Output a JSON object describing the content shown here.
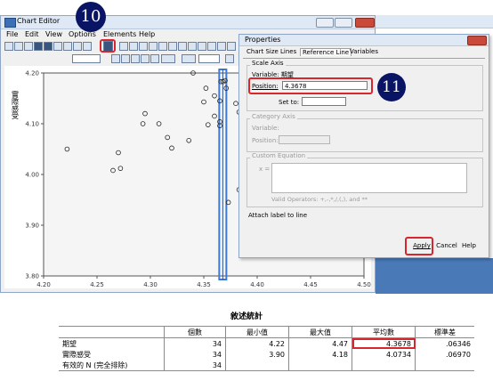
{
  "steps": {
    "first": "10",
    "second": "11"
  },
  "chart_editor": {
    "title": "Chart Editor",
    "menu": [
      "File",
      "Edit",
      "View",
      "Options",
      "Elements",
      "Help"
    ]
  },
  "properties": {
    "title": "Properties",
    "tabs": [
      "Chart Size",
      "Lines",
      "Reference Line",
      "Variables"
    ],
    "scale_axis": {
      "group_label": "Scale Axis",
      "variable_label": "Variable: 期望",
      "position_label": "Position:",
      "position_value": "4.3678",
      "set_to_label": "Set to:"
    },
    "category_axis": {
      "group_label": "Category Axis",
      "variable_label": "Variable:",
      "position_label": "Position:"
    },
    "custom_equation": {
      "group_label": "Custom Equation",
      "x_label": "x =",
      "valid_operators": "Valid Operators: +,-,*,/,(,), and **"
    },
    "attach_label": "Attach label to line",
    "buttons": {
      "apply": "Apply",
      "cancel": "Cancel",
      "help": "Help"
    }
  },
  "chart_data": {
    "type": "scatter",
    "xlabel": "期望",
    "ylabel": "實際感受",
    "xlim": [
      4.2,
      4.5
    ],
    "ylim": [
      3.8,
      4.2
    ],
    "x_ticks": [
      "4.20",
      "4.25",
      "4.30",
      "4.35",
      "4.40",
      "4.45",
      "4.50"
    ],
    "y_ticks": [
      "3.80",
      "3.90",
      "4.00",
      "4.10",
      "4.20"
    ],
    "reference_line_x": 4.3678,
    "points": [
      {
        "x": 4.222,
        "y": 4.05
      },
      {
        "x": 4.265,
        "y": 4.008
      },
      {
        "x": 4.27,
        "y": 4.043
      },
      {
        "x": 4.272,
        "y": 4.012
      },
      {
        "x": 4.293,
        "y": 4.1
      },
      {
        "x": 4.295,
        "y": 4.12
      },
      {
        "x": 4.308,
        "y": 4.1
      },
      {
        "x": 4.316,
        "y": 4.073
      },
      {
        "x": 4.32,
        "y": 4.052
      },
      {
        "x": 4.336,
        "y": 4.067
      },
      {
        "x": 4.35,
        "y": 4.143
      },
      {
        "x": 4.352,
        "y": 4.17
      },
      {
        "x": 4.354,
        "y": 4.098
      },
      {
        "x": 4.36,
        "y": 4.155
      },
      {
        "x": 4.366,
        "y": 4.183
      },
      {
        "x": 4.368,
        "y": 4.183
      },
      {
        "x": 4.36,
        "y": 4.115
      },
      {
        "x": 4.37,
        "y": 4.185
      },
      {
        "x": 4.371,
        "y": 4.17
      },
      {
        "x": 4.365,
        "y": 4.145
      },
      {
        "x": 4.38,
        "y": 4.14
      },
      {
        "x": 4.388,
        "y": 4.13
      },
      {
        "x": 4.39,
        "y": 4.1
      },
      {
        "x": 4.365,
        "y": 4.104
      },
      {
        "x": 4.365,
        "y": 4.096
      },
      {
        "x": 4.373,
        "y": 3.945
      },
      {
        "x": 4.383,
        "y": 3.97
      },
      {
        "x": 4.34,
        "y": 4.2
      },
      {
        "x": 4.383,
        "y": 4.123
      }
    ]
  },
  "stats": {
    "title": "敘述統計",
    "headers": [
      "",
      "個數",
      "最小值",
      "最大值",
      "平均數",
      "標準差"
    ],
    "rows": [
      [
        "期望",
        "34",
        "4.22",
        "4.47",
        "4.3678",
        ".06346"
      ],
      [
        "實際感受",
        "34",
        "3.90",
        "4.18",
        "4.0734",
        ".06970"
      ],
      [
        "有效的 N (完全排除)",
        "34",
        "",
        "",
        "",
        ""
      ]
    ]
  },
  "colors": {
    "highlight": "#d9262e",
    "badge": "#0a1464",
    "refline": "#3b7ad9"
  }
}
